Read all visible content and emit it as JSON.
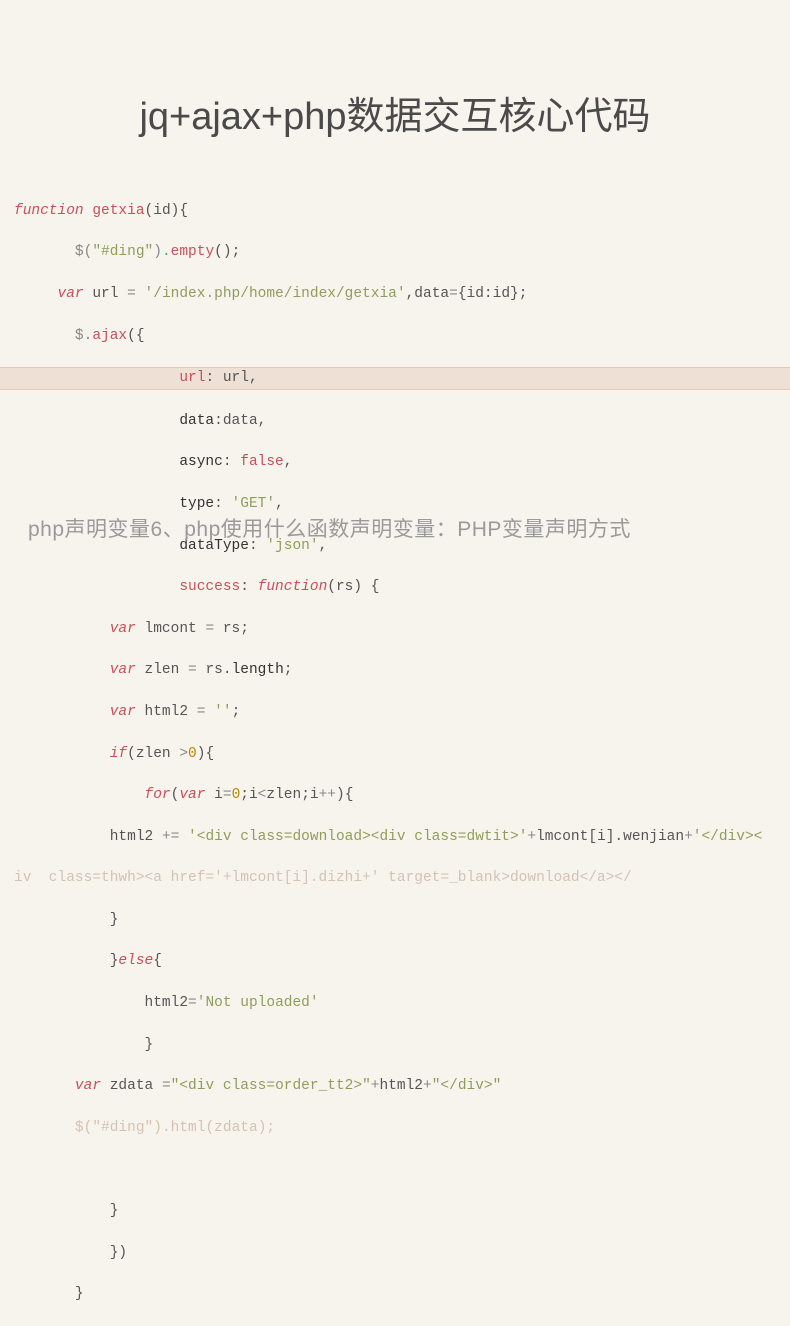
{
  "title": "jq+ajax+php数据交互核心代码",
  "overlay": "php声明变量6、php使用什么函数声明变量：PHP变量声明方式",
  "code": {
    "fn_kw": "function",
    "fn_name": "getxia",
    "fn_arg": "id",
    "l2_sel": "\"#ding\"",
    "l2_m": "empty",
    "l3_var": "var",
    "l3_url_k": "url",
    "l3_url_v": "'/index.php/home/index/getxia'",
    "l3_data_k": "data",
    "l3_data_v": "id:id",
    "l4_ajax": "ajax",
    "l5_url_k": "url",
    "l5_url_v": "url",
    "l6_data_k": "data",
    "l6_data_v": "data",
    "l7_async_k": "async",
    "l7_async_v": "false",
    "l8_type_k": "type",
    "l8_type_v": "'GET'",
    "l9_dt_k": "dataType",
    "l9_dt_v": "'json'",
    "l10_succ_k": "success",
    "l10_fn": "function",
    "l10_arg": "rs",
    "l11_var": "var",
    "l11_lmcont": "lmcont",
    "l11_rs": "rs",
    "l12_var": "var",
    "l12_zlen": "zlen",
    "l12_rs": "rs",
    "l12_len": "length",
    "l13_var": "var",
    "l13_html2": "html2",
    "l13_empty": "''",
    "l14_if": "if",
    "l14_zlen": "zlen",
    "l14_gt": ">",
    "l14_zero": "0",
    "l15_for": "for",
    "l15_var": "var",
    "l15_i": "i",
    "l15_zero": "0",
    "l15_zlen": "zlen",
    "l16_html2": "html2",
    "l16_str1": "'<div class=download><div class=dwtit>'",
    "l16_lmcont": "lmcont",
    "l16_i": "i",
    "l16_wenjian": "wenjian",
    "l16_tail": "'</div><",
    "l17_faded": "iv  class=thwh><a href='+lmcont[i].dizhi+' target=_blank>download</a></",
    "l18_brace": "}",
    "l19_else": "else",
    "l20_html2": "html2",
    "l20_str": "'Not uploaded'",
    "l21_brace": "}",
    "l22_var": "var",
    "l22_zdata": "zdata",
    "l22_str1": "\"<div class=order_tt2>\"",
    "l22_html2": "html2",
    "l22_str2": "\"</div>\"",
    "l23_sel": "\"#ding\"",
    "l23_m": "html",
    "l23_arg": "zdata",
    "l24_brace": "}",
    "l25_brace": "})",
    "l26_brace": "}"
  }
}
